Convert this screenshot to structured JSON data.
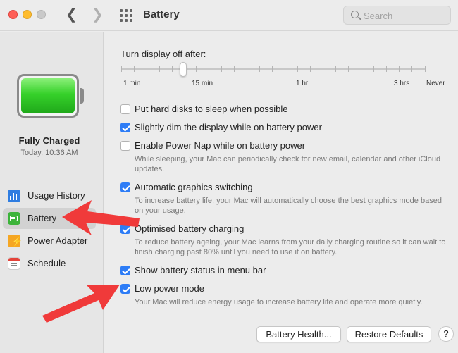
{
  "window": {
    "title": "Battery"
  },
  "search": {
    "placeholder": "Search"
  },
  "sidebar": {
    "status_title": "Fully Charged",
    "status_time": "Today, 10:36 AM",
    "items": [
      {
        "label": "Usage History",
        "icon": "usage-history-icon",
        "active": false
      },
      {
        "label": "Battery",
        "icon": "battery-icon",
        "active": true
      },
      {
        "label": "Power Adapter",
        "icon": "power-adapter-icon",
        "active": false
      },
      {
        "label": "Schedule",
        "icon": "schedule-icon",
        "active": false
      }
    ]
  },
  "main": {
    "slider": {
      "label": "Turn display off after:",
      "value": "10 min",
      "ticks": [
        "1 min",
        "15 min",
        "1 hr",
        "3 hrs",
        "Never"
      ]
    },
    "options": [
      {
        "label": "Put hard disks to sleep when possible",
        "checked": false,
        "desc": ""
      },
      {
        "label": "Slightly dim the display while on battery power",
        "checked": true,
        "desc": ""
      },
      {
        "label": "Enable Power Nap while on battery power",
        "checked": false,
        "desc": "While sleeping, your Mac can periodically check for new email, calendar and other iCloud updates."
      },
      {
        "label": "Automatic graphics switching",
        "checked": true,
        "desc": "To increase battery life, your Mac will automatically choose the best graphics mode based on your usage."
      },
      {
        "label": "Optimised battery charging",
        "checked": true,
        "desc": "To reduce battery ageing, your Mac learns from your daily charging routine so it can wait to finish charging past 80% until you need to use it on battery."
      },
      {
        "label": "Show battery status in menu bar",
        "checked": true,
        "desc": ""
      },
      {
        "label": "Low power mode",
        "checked": true,
        "desc": "Your Mac will reduce energy usage to increase battery life and operate more quietly."
      }
    ],
    "buttons": {
      "battery_health": "Battery Health...",
      "restore_defaults": "Restore Defaults",
      "help": "?"
    }
  },
  "colors": {
    "accent": "#2d7cf6",
    "battery_green": "#36d12a",
    "annotation_arrow": "#f03a3a"
  }
}
